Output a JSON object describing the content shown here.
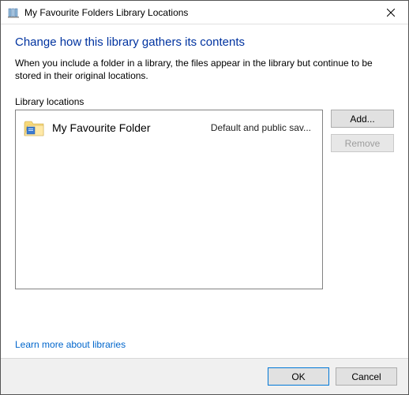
{
  "window": {
    "title": "My Favourite Folders Library Locations"
  },
  "heading": "Change how this library gathers its contents",
  "description": "When you include a folder in a library, the files appear in the library but continue to be stored in their original locations.",
  "locationsLabel": "Library locations",
  "list": {
    "items": [
      {
        "name": "My Favourite Folder",
        "status": "Default and public sav..."
      }
    ]
  },
  "buttons": {
    "add": "Add...",
    "remove": "Remove",
    "ok": "OK",
    "cancel": "Cancel"
  },
  "link": "Learn more about libraries"
}
